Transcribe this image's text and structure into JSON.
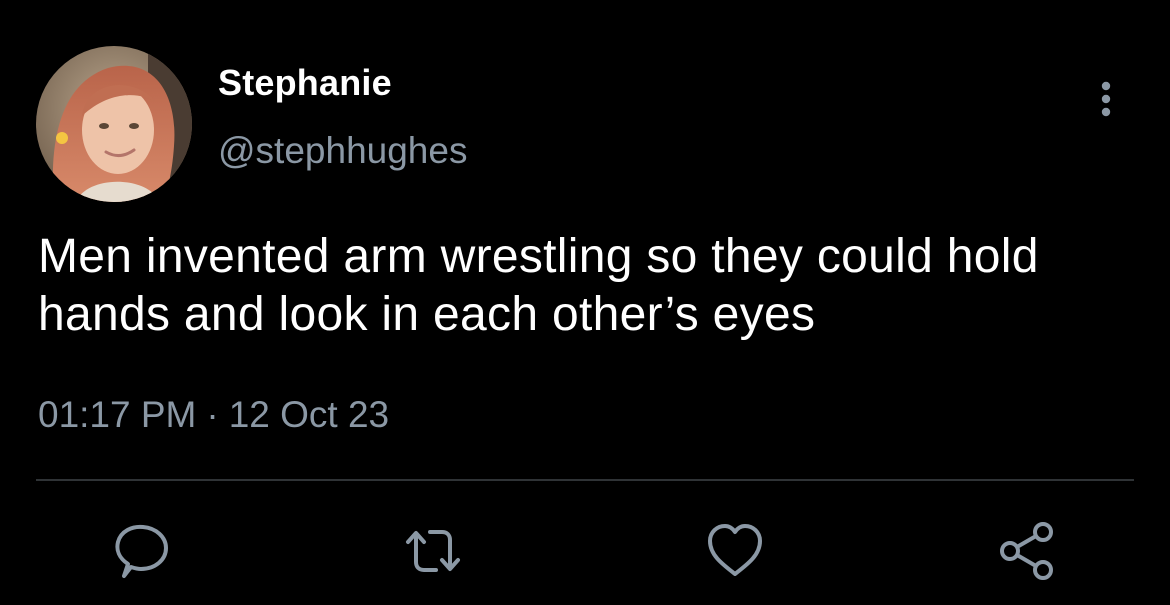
{
  "tweet": {
    "display_name": "Stephanie",
    "handle": "@stephhughes",
    "text": "Men invented arm wrestling so they could hold hands and look in each other’s eyes",
    "time": "01:17 PM",
    "separator": "·",
    "date": "12 Oct 23"
  },
  "icons": {
    "more": "more-vertical-icon",
    "reply": "reply-icon",
    "retweet": "retweet-icon",
    "like": "heart-icon",
    "share": "share-icon"
  },
  "colors": {
    "background": "#000000",
    "primary_text": "#ffffff",
    "secondary_text": "#8b98a5",
    "divider": "#2f3336"
  }
}
